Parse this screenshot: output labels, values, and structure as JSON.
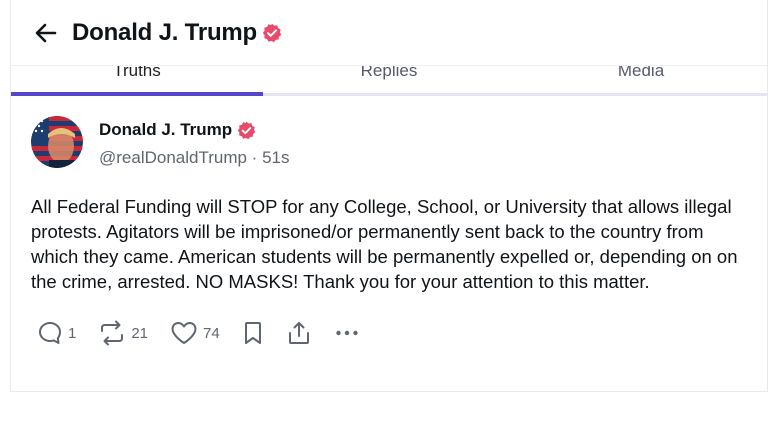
{
  "header": {
    "title": "Donald J. Trump",
    "icons": {
      "back": "arrow-left-icon",
      "verified": "verified-badge-icon"
    }
  },
  "tabs": [
    {
      "label": "Truths",
      "active": true
    },
    {
      "label": "Replies",
      "active": false
    },
    {
      "label": "Media",
      "active": false
    }
  ],
  "post": {
    "author": {
      "display_name": "Donald J. Trump",
      "handle_time": "@realDonaldTrump · 51s",
      "avatar": "avatar-image"
    },
    "body": "All Federal Funding will STOP for any College, School, or University that allows illegal protests. Agitators will be imprisoned/or permanently sent back to the country from which they came. American students will be permanently expelled or, depending on on the crime, arrested. NO MASKS! Thank you for your attention to this matter.",
    "actions": {
      "reply": {
        "icon": "reply-icon",
        "count": "1"
      },
      "retruth": {
        "icon": "retruth-icon",
        "count": "21"
      },
      "like": {
        "icon": "heart-icon",
        "count": "74"
      },
      "bookmark": {
        "icon": "bookmark-icon"
      },
      "share": {
        "icon": "share-icon"
      },
      "more": {
        "icon": "more-icon"
      }
    }
  },
  "colors": {
    "accent": "#5448c8",
    "verified": "#e94a6a",
    "text": "#0f1419",
    "muted": "#5f6672"
  }
}
